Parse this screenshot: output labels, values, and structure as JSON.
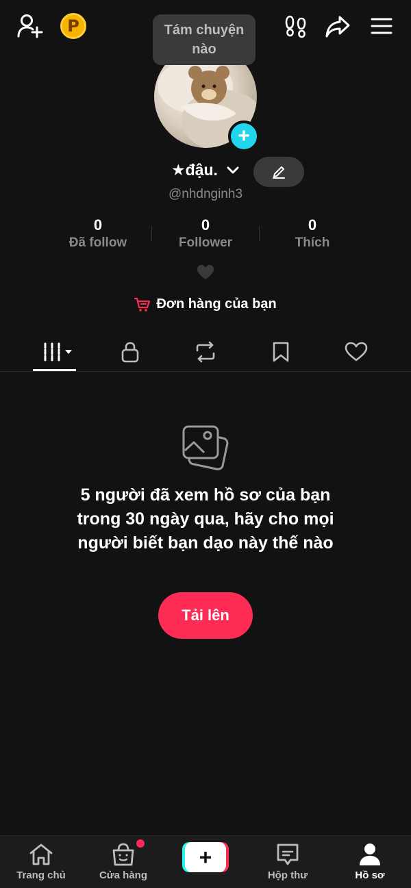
{
  "topbar": {
    "coin_label": "P",
    "icons": [
      "add-friend-icon",
      "points-coin-icon",
      "footprints-icon",
      "share-icon",
      "menu-icon"
    ]
  },
  "tooltip": {
    "text_line1": "Tám chuyện",
    "text_line2": "nào"
  },
  "profile": {
    "display_name": "★đậu.",
    "username": "@nhdnginh3",
    "add_badge": "+"
  },
  "stats": [
    {
      "value": "0",
      "label": "Đã follow"
    },
    {
      "value": "0",
      "label": "Follower"
    },
    {
      "value": "0",
      "label": "Thích"
    }
  ],
  "orders": {
    "label": "Đơn hàng của bạn"
  },
  "tabs": [
    {
      "id": "videos",
      "icon": "grid-icon",
      "active": true
    },
    {
      "id": "private",
      "icon": "lock-icon",
      "active": false
    },
    {
      "id": "reposts",
      "icon": "repost-icon",
      "active": false
    },
    {
      "id": "favorites",
      "icon": "bookmark-icon",
      "active": false
    },
    {
      "id": "liked",
      "icon": "heart-icon",
      "active": false
    }
  ],
  "empty_state": {
    "message": "5 người đã xem hồ sơ của bạn trong 30 ngày qua, hãy cho mọi người biết bạn dạo này thế nào",
    "button_label": "Tải lên"
  },
  "bottom_nav": [
    {
      "label": "Trang chủ",
      "icon": "home-icon"
    },
    {
      "label": "Cửa hàng",
      "icon": "shop-icon",
      "has_dot": true
    },
    {
      "label": "",
      "icon": "create-icon"
    },
    {
      "label": "Hộp thư",
      "icon": "inbox-icon"
    },
    {
      "label": "Hồ sơ",
      "icon": "profile-icon",
      "active": true
    }
  ],
  "colors": {
    "background": "#121212",
    "accent": "#fe2c55",
    "cyan": "#20d5ec",
    "muted_text": "#8a8a8a"
  }
}
